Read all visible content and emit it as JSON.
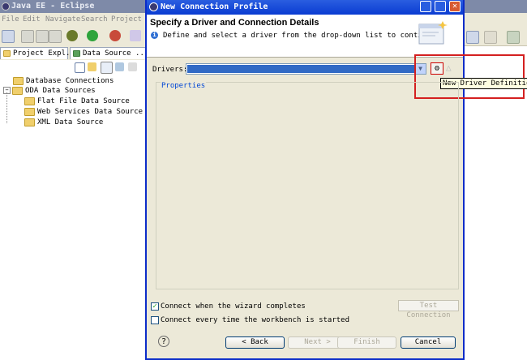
{
  "background": {
    "title": "Java EE - Eclipse",
    "menu": [
      "File",
      "Edit",
      "Navigate",
      "Search",
      "Project"
    ],
    "tabs": [
      "Project Expl...",
      "Data Source ..."
    ],
    "tree": [
      {
        "label": "Database Connections"
      },
      {
        "label": "ODA Data Sources"
      },
      {
        "label": "Flat File Data Source"
      },
      {
        "label": "Web Services Data Source"
      },
      {
        "label": "XML Data Source"
      }
    ]
  },
  "dialog": {
    "title": "New Connection Profile",
    "header_title": "Specify a Driver and Connection Details",
    "header_desc": "Define and select a driver from the drop-down list to continue.",
    "drivers_label": "Drivers:",
    "drivers_value": "",
    "new_driver_tooltip": "New Driver Definition",
    "properties_label": "Properties",
    "connect_on_complete": "Connect when the wizard completes",
    "connect_on_complete_checked": true,
    "connect_on_start": "Connect every time the workbench is started",
    "connect_on_start_checked": false,
    "test_connection": "Test Connection",
    "buttons": {
      "back": "< Back",
      "next": "Next >",
      "finish": "Finish",
      "cancel": "Cancel"
    }
  },
  "colors": {
    "titlebar": "#0a3bd2",
    "selection": "#316ac5",
    "highlight": "#d42020"
  }
}
